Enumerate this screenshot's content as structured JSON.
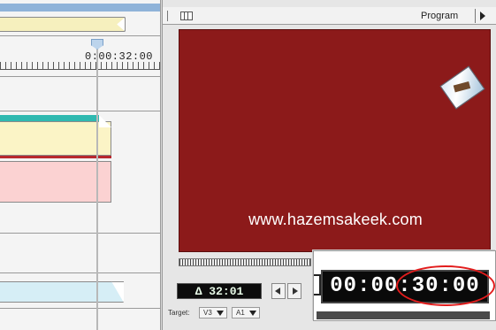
{
  "timeline": {
    "current_time": "0:00:32:00"
  },
  "monitor": {
    "title": "Program",
    "watermark": "www.hazemsakeek.com",
    "duration": "Δ 32:01",
    "target_label": "Target:",
    "target_video": "V3",
    "target_audio": "A1",
    "zoom_timecode": "00:00:30:00"
  },
  "colors": {
    "video_background": "#8c1a1a",
    "highlight_ellipse": "#e21c1c",
    "clip_teal": "#2fb9b0",
    "clip_yellow": "#fbf4c6",
    "clip_pink": "#fbd2d2",
    "clip_blue": "#d6eef6"
  },
  "icons": {
    "monitor_window_icon": "window-icon",
    "monitor_menu_icon": "triangle-right-icon",
    "step_back_icon": "step-back-icon",
    "step_forward_icon": "step-forward-icon",
    "dropdown_icon": "chevron-down-icon"
  }
}
